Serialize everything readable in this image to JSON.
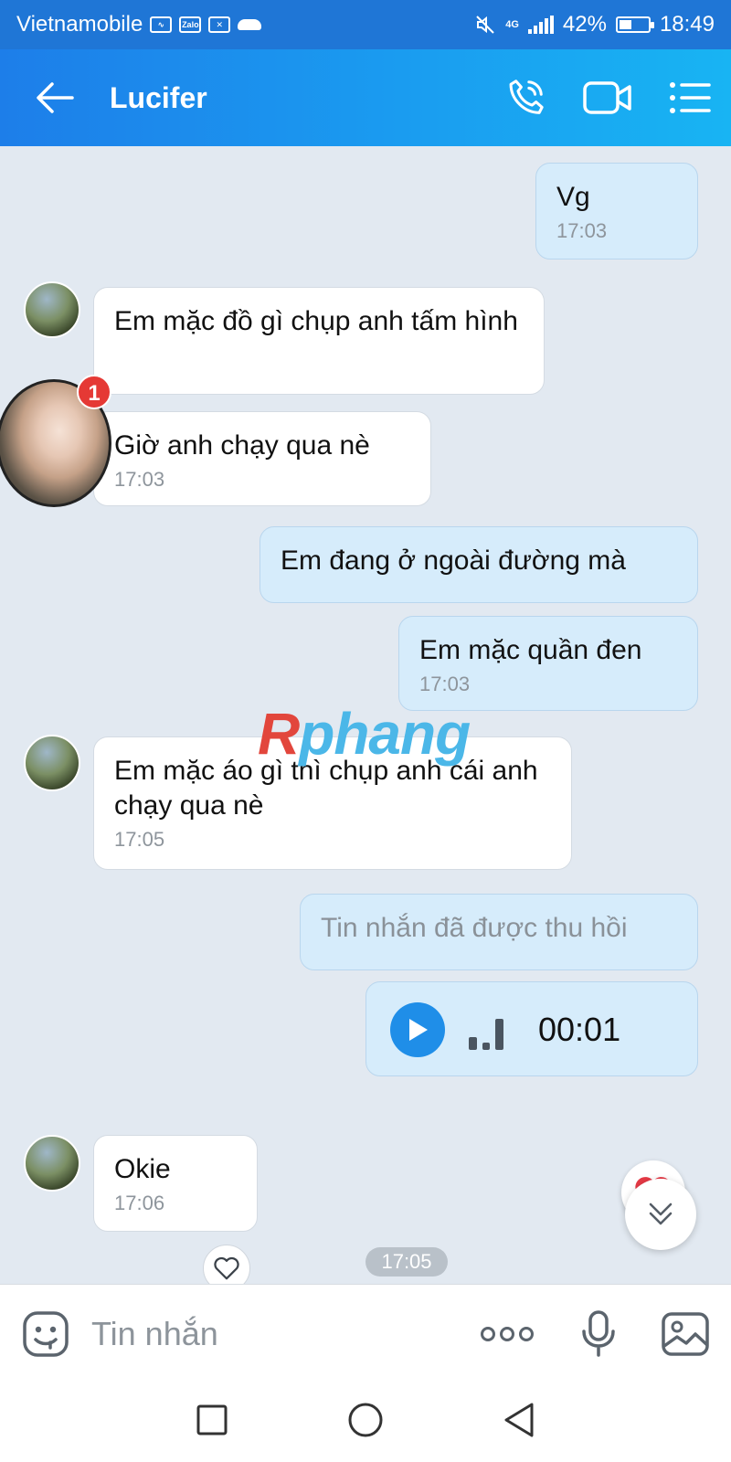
{
  "status_bar": {
    "carrier": "Vietnamobile",
    "zalo_label": "Zalo",
    "network": "4G",
    "battery": "42%",
    "battery_level": 0.42,
    "time": "18:49"
  },
  "header": {
    "title": "Lucifer"
  },
  "messages": [
    {
      "dir": "out",
      "text": "Vg",
      "time": "17:03"
    },
    {
      "dir": "in",
      "text": "Em mặc đồ gì chụp anh tấm hình"
    },
    {
      "dir": "in",
      "text": "Giờ anh chạy qua nè",
      "time": "17:03"
    },
    {
      "dir": "out",
      "text": "Em đang ở ngoài đường mà"
    },
    {
      "dir": "out",
      "text": "Em mặc quần đen",
      "time": "17:03"
    },
    {
      "dir": "in",
      "text": "Em mặc áo gì thì chụp anh cái anh chạy qua nè",
      "time": "17:05"
    },
    {
      "dir": "out",
      "text": "Tin nhắn đã được thu hồi",
      "recalled": true
    },
    {
      "dir": "out",
      "type": "voice",
      "duration": "00:01"
    },
    {
      "dir": "in",
      "text": "Okie",
      "time": "17:06"
    }
  ],
  "time_pill": "17:05",
  "chat_head_badge": "1",
  "watermark": {
    "r": "R",
    "rest": "phang"
  },
  "input": {
    "placeholder": "Tin nhắn"
  },
  "colors": {
    "header_start": "#1d7ee9",
    "header_end": "#18b4f3",
    "outgoing_bubble": "#d6ecfb",
    "incoming_bubble": "#ffffff",
    "chat_bg": "#e2e9f1",
    "play_button": "#1f8ee8",
    "heart": "#e53945"
  }
}
